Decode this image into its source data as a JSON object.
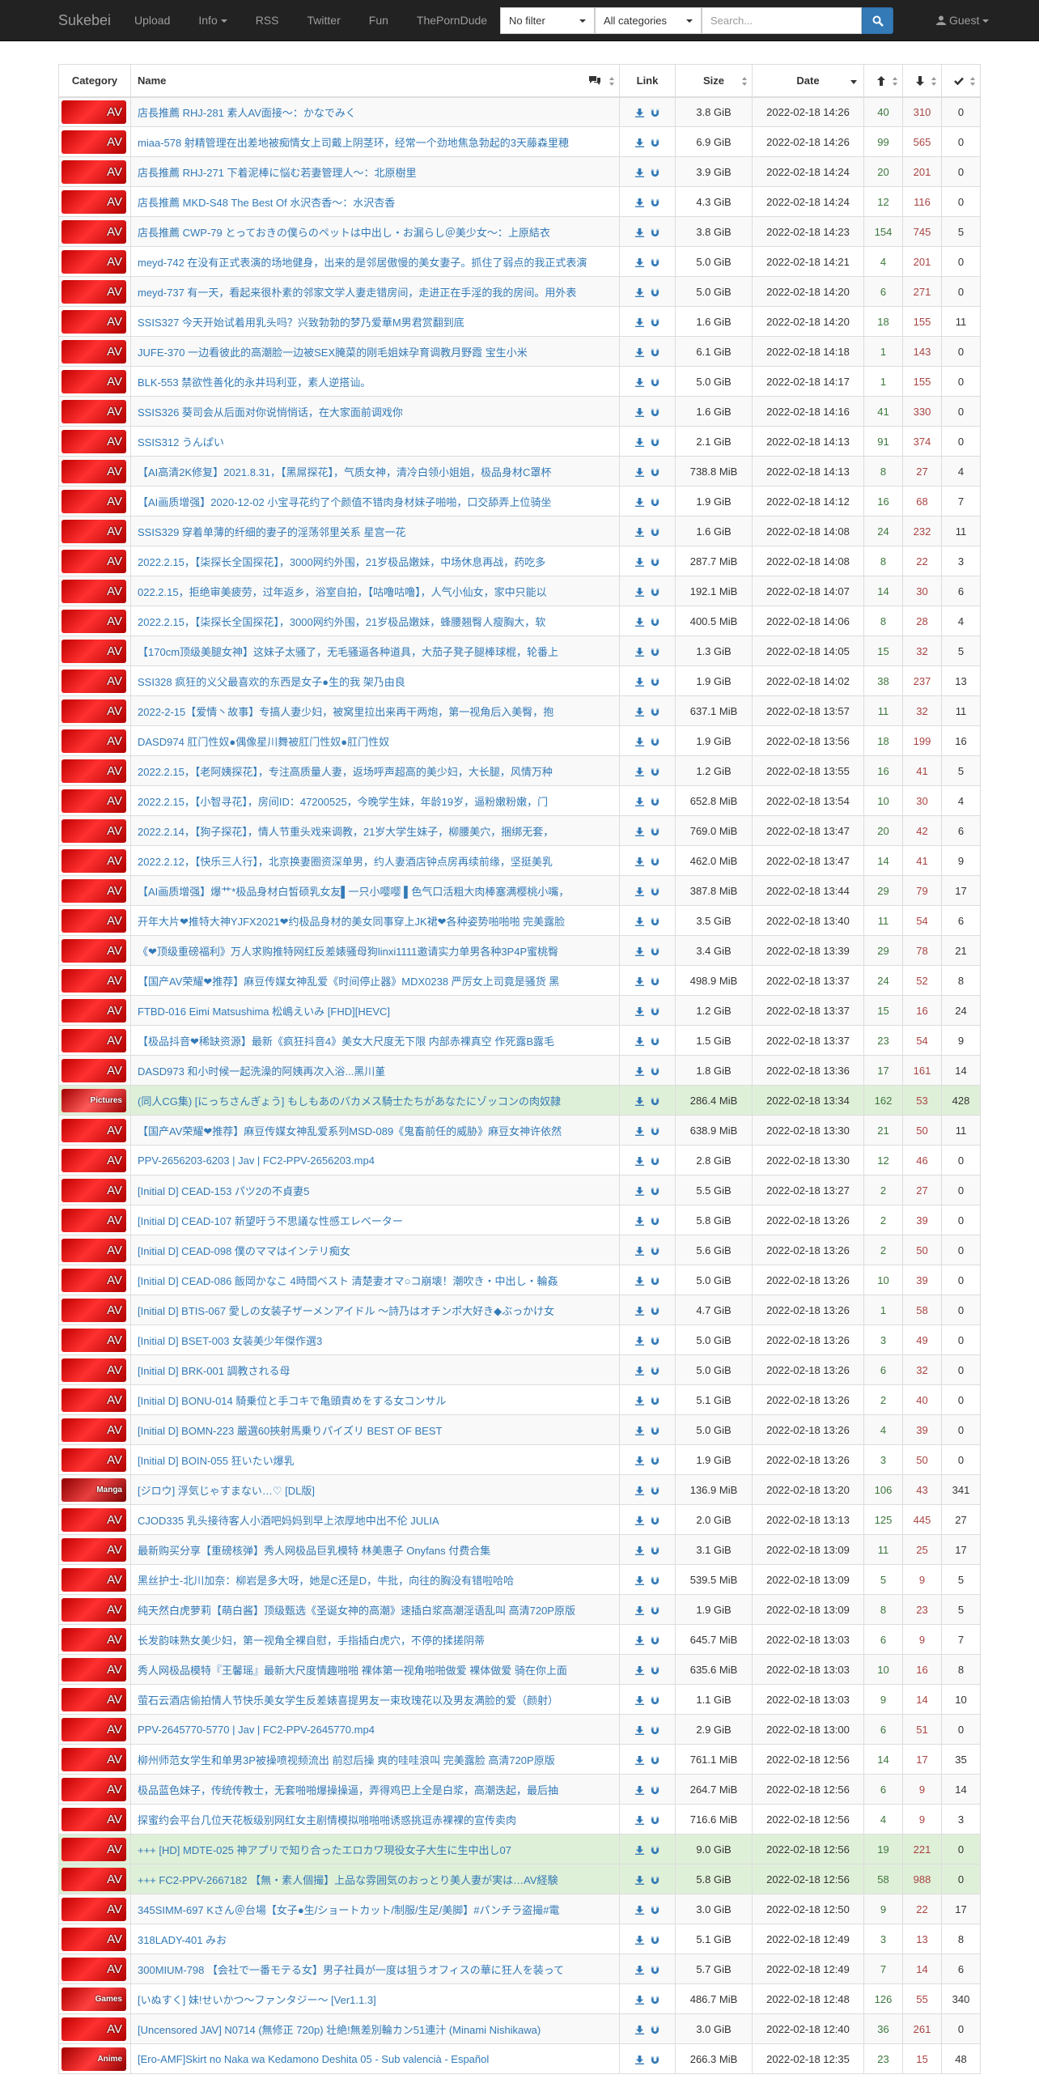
{
  "navbar": {
    "brand": "Sukebei",
    "links": [
      "Upload",
      "Info",
      "RSS",
      "Twitter",
      "Fun",
      "ThePornDude"
    ],
    "filter_value": "No filter",
    "category_value": "All categories",
    "search_placeholder": "Search...",
    "user_label": "Guest"
  },
  "table": {
    "headers": {
      "category": "Category",
      "name": "Name",
      "link": "Link",
      "size": "Size",
      "date": "Date"
    },
    "rows": [
      {
        "cat": "AV",
        "name": "店長推薦 RHJ-281 素人AV面接～：かなでみく",
        "size": "3.8 GiB",
        "date": "2022-02-18 14:26",
        "seed": "40",
        "leech": "310",
        "done": "0",
        "hl": false
      },
      {
        "cat": "AV",
        "name": "miaa-578 射精管理在出差地被痴情女上司戴上阴茎环，经常一个劲地焦急勃起的3天藤森里穂",
        "size": "6.9 GiB",
        "date": "2022-02-18 14:26",
        "seed": "99",
        "leech": "565",
        "done": "0",
        "hl": false
      },
      {
        "cat": "AV",
        "name": "店長推薦 RHJ-271 下着泥棒に悩む若妻管理人～：北原樹里",
        "size": "3.9 GiB",
        "date": "2022-02-18 14:24",
        "seed": "20",
        "leech": "201",
        "done": "0",
        "hl": false
      },
      {
        "cat": "AV",
        "name": "店長推薦 MKD-S48 The Best Of 水沢杏香～：水沢杏香",
        "size": "4.3 GiB",
        "date": "2022-02-18 14:24",
        "seed": "12",
        "leech": "116",
        "done": "0",
        "hl": false
      },
      {
        "cat": "AV",
        "name": "店長推薦 CWP-79 とっておきの僕らのペットは中出し・お漏らし＠美少女～：上原結衣",
        "size": "3.8 GiB",
        "date": "2022-02-18 14:23",
        "seed": "154",
        "leech": "745",
        "done": "5",
        "hl": false
      },
      {
        "cat": "AV",
        "name": "meyd-742 在没有正式表演的场地健身，出来的是邻居傲慢的美女妻子。抓住了弱点的我正式表演",
        "size": "5.0 GiB",
        "date": "2022-02-18 14:21",
        "seed": "4",
        "leech": "201",
        "done": "0",
        "hl": false
      },
      {
        "cat": "AV",
        "name": "meyd-737 有一天，看起来很朴素的邻家文学人妻走错房间，走进正在手淫的我的房间。用外表",
        "size": "5.0 GiB",
        "date": "2022-02-18 14:20",
        "seed": "6",
        "leech": "271",
        "done": "0",
        "hl": false
      },
      {
        "cat": "AV",
        "name": "SSIS327 今天开始试着用乳头吗？兴致勃勃的梦乃爱華M男君赏翻到底",
        "size": "1.6 GiB",
        "date": "2022-02-18 14:20",
        "seed": "18",
        "leech": "155",
        "done": "11",
        "hl": false
      },
      {
        "cat": "AV",
        "name": "JUFE-370 一边看彼此的高潮脸一边被SEX腌菜的刚毛姐妹孕育调教月野霞 宝生小米",
        "size": "6.1 GiB",
        "date": "2022-02-18 14:18",
        "seed": "1",
        "leech": "143",
        "done": "0",
        "hl": false
      },
      {
        "cat": "AV",
        "name": "BLK-553 禁欲性善化的永井玛利亚，素人逆搭讪。",
        "size": "5.0 GiB",
        "date": "2022-02-18 14:17",
        "seed": "1",
        "leech": "155",
        "done": "0",
        "hl": false
      },
      {
        "cat": "AV",
        "name": "SSIS326 葵司会从后面对你说悄悄话，在大家面前调戏你",
        "size": "1.6 GiB",
        "date": "2022-02-18 14:16",
        "seed": "41",
        "leech": "330",
        "done": "0",
        "hl": false
      },
      {
        "cat": "AV",
        "name": "SSIS312 うんぱい",
        "size": "2.1 GiB",
        "date": "2022-02-18 14:13",
        "seed": "91",
        "leech": "374",
        "done": "0",
        "hl": false
      },
      {
        "cat": "AV",
        "name": "【AI高清2K修复】2021.8.31，【黑屌探花】，气质女神，清冷白领小姐姐，极品身材C罩杯",
        "size": "738.8 MiB",
        "date": "2022-02-18 14:13",
        "seed": "8",
        "leech": "27",
        "done": "4",
        "hl": false
      },
      {
        "cat": "AV",
        "name": "【AI画质增强】2020-12-02 小宝寻花约了个颜值不错肉身材妹子啪啪，口交舔弄上位骑坐",
        "size": "1.9 GiB",
        "date": "2022-02-18 14:12",
        "seed": "16",
        "leech": "68",
        "done": "7",
        "hl": false
      },
      {
        "cat": "AV",
        "name": "SSIS329 穿着单薄的纤细的妻子的淫荡邻里关系 星宫一花",
        "size": "1.6 GiB",
        "date": "2022-02-18 14:08",
        "seed": "24",
        "leech": "232",
        "done": "11",
        "hl": false
      },
      {
        "cat": "AV",
        "name": "2022.2.15，【柒探长全国探花】，3000网约外围，21岁极品嫩妹，中场休息再战，药吃多",
        "size": "287.7 MiB",
        "date": "2022-02-18 14:08",
        "seed": "8",
        "leech": "22",
        "done": "3",
        "hl": false
      },
      {
        "cat": "AV",
        "name": "022.2.15，拒绝审美疲劳，过年返乡，浴室自拍，【咕噜咕噜】，人气小仙女，家中只能以",
        "size": "192.1 MiB",
        "date": "2022-02-18 14:07",
        "seed": "14",
        "leech": "30",
        "done": "6",
        "hl": false
      },
      {
        "cat": "AV",
        "name": "2022.2.15，【柒探长全国探花】，3000网约外围，21岁极品嫩妹，蜂腰翘臀人瘦胸大，软",
        "size": "400.5 MiB",
        "date": "2022-02-18 14:06",
        "seed": "8",
        "leech": "28",
        "done": "4",
        "hl": false
      },
      {
        "cat": "AV",
        "name": "【170cm顶级美腿女神】这妹子太骚了，无毛骚逼各种道具，大茄子凳子腿棒球棍，轮番上",
        "size": "1.3 GiB",
        "date": "2022-02-18 14:05",
        "seed": "15",
        "leech": "32",
        "done": "5",
        "hl": false
      },
      {
        "cat": "AV",
        "name": "SSI328 疯狂的义父最喜欢的东西是女子●生的我 架乃由良",
        "size": "1.9 GiB",
        "date": "2022-02-18 14:02",
        "seed": "38",
        "leech": "237",
        "done": "13",
        "hl": false
      },
      {
        "cat": "AV",
        "name": "2022-2-15【爱情丶故事】专搞人妻少妇，被窝里拉出来再干两炮，第一视角后入美臀，抱",
        "size": "637.1 MiB",
        "date": "2022-02-18 13:57",
        "seed": "11",
        "leech": "32",
        "done": "11",
        "hl": false
      },
      {
        "cat": "AV",
        "name": "DASD974 肛门性奴●偶像星川舞被肛门性奴●肛门性奴",
        "size": "1.9 GiB",
        "date": "2022-02-18 13:56",
        "seed": "18",
        "leech": "199",
        "done": "16",
        "hl": false
      },
      {
        "cat": "AV",
        "name": "2022.2.15，【老阿姨探花】，专注高质量人妻，返场呼声超高的美少妇，大长腿，风情万种",
        "size": "1.2 GiB",
        "date": "2022-02-18 13:55",
        "seed": "16",
        "leech": "41",
        "done": "5",
        "hl": false
      },
      {
        "cat": "AV",
        "name": "2022.2.15，【小智寻花】，房间ID：47200525，今晚学生妹，年龄19岁，逼粉嫩粉嫩，门",
        "size": "652.8 MiB",
        "date": "2022-02-18 13:54",
        "seed": "10",
        "leech": "30",
        "done": "4",
        "hl": false
      },
      {
        "cat": "AV",
        "name": "2022.2.14，【狗子探花】，情人节重头戏来调教，21岁大学生妹子，柳腰美穴，捆绑无套，",
        "size": "769.0 MiB",
        "date": "2022-02-18 13:47",
        "seed": "20",
        "leech": "42",
        "done": "6",
        "hl": false
      },
      {
        "cat": "AV",
        "name": "2022.2.12，【快乐三人行】，北京换妻圈资深单男，约人妻酒店钟点房再续前缘，坚挺美乳",
        "size": "462.0 MiB",
        "date": "2022-02-18 13:47",
        "seed": "14",
        "leech": "41",
        "done": "9",
        "hl": false
      },
      {
        "cat": "AV",
        "name": "【AI画质增强】爆艹*极品身材白皙硕乳女友▌一只小嘤嘤 ▌色气口活粗大肉棒塞满樱桃小嘴，",
        "size": "387.8 MiB",
        "date": "2022-02-18 13:44",
        "seed": "29",
        "leech": "79",
        "done": "17",
        "hl": false
      },
      {
        "cat": "AV",
        "name": "开年大片❤推特大神YJFX2021❤约极品身材的美女同事穿上JK裙❤各种姿势啪啪啪 完美露脸",
        "size": "3.5 GiB",
        "date": "2022-02-18 13:40",
        "seed": "11",
        "leech": "54",
        "done": "6",
        "hl": false
      },
      {
        "cat": "AV",
        "name": "《❤顶级重磅福利》万人求购推特网红反差婊骚母狗linxi1111邀请实力单男各种3P4P蜜桃臀",
        "size": "3.4 GiB",
        "date": "2022-02-18 13:39",
        "seed": "29",
        "leech": "78",
        "done": "21",
        "hl": false
      },
      {
        "cat": "AV",
        "name": "【国产AV荣耀❤推荐】麻豆传媒女神乱爱《时间停止器》MDX0238 严厉女上司竟是骚货 黑",
        "size": "498.9 MiB",
        "date": "2022-02-18 13:37",
        "seed": "24",
        "leech": "52",
        "done": "8",
        "hl": false
      },
      {
        "cat": "AV",
        "name": "FTBD-016 Eimi Matsushima 松嶋えいみ [FHD][HEVC]",
        "size": "1.2 GiB",
        "date": "2022-02-18 13:37",
        "seed": "15",
        "leech": "16",
        "done": "24",
        "hl": false
      },
      {
        "cat": "AV",
        "name": "【极品抖音❤稀缺资源】最新《疯狂抖音4》美女大尺度无下限 内部赤裸真空 作死露B露毛",
        "size": "1.5 GiB",
        "date": "2022-02-18 13:37",
        "seed": "23",
        "leech": "54",
        "done": "9",
        "hl": false
      },
      {
        "cat": "AV",
        "name": "DASD973 和小时候一起洗澡的阿姨再次入浴...黑川堇",
        "size": "1.8 GiB",
        "date": "2022-02-18 13:36",
        "seed": "17",
        "leech": "161",
        "done": "14",
        "hl": false
      },
      {
        "cat": "Pictures",
        "name": "(同人CG集) [にっちさんぎょう] もしもあのバカメス騎士たちがあなたにゾッコンの肉奴隷",
        "size": "286.4 MiB",
        "date": "2022-02-18 13:34",
        "seed": "162",
        "leech": "53",
        "done": "428",
        "hl": true
      },
      {
        "cat": "AV",
        "name": "【国产AV荣耀❤推荐】麻豆传媒女神乱爱系列MSD-089《鬼畜前任的威胁》麻豆女神许依然",
        "size": "638.9 MiB",
        "date": "2022-02-18 13:30",
        "seed": "21",
        "leech": "50",
        "done": "11",
        "hl": false
      },
      {
        "cat": "AV",
        "name": "PPV-2656203-6203 | Jav | FC2-PPV-2656203.mp4",
        "size": "2.8 GiB",
        "date": "2022-02-18 13:30",
        "seed": "12",
        "leech": "46",
        "done": "0",
        "hl": false
      },
      {
        "cat": "AV",
        "name": "[Initial D] CEAD-153 パツ2の不貞妻5",
        "size": "5.5 GiB",
        "date": "2022-02-18 13:27",
        "seed": "2",
        "leech": "27",
        "done": "0",
        "hl": false
      },
      {
        "cat": "AV",
        "name": "[Initial D] CEAD-107 新望吁う不思議な性感エレベーター",
        "size": "5.8 GiB",
        "date": "2022-02-18 13:26",
        "seed": "2",
        "leech": "39",
        "done": "0",
        "hl": false
      },
      {
        "cat": "AV",
        "name": "[Initial D] CEAD-098 僕のママはインテリ痴女",
        "size": "5.6 GiB",
        "date": "2022-02-18 13:26",
        "seed": "2",
        "leech": "50",
        "done": "0",
        "hl": false
      },
      {
        "cat": "AV",
        "name": "[Initial D] CEAD-086 飯岡かなこ 4時間ベスト 清楚妻オマ○コ崩壊！潮吹き・中出し・輪姦",
        "size": "5.0 GiB",
        "date": "2022-02-18 13:26",
        "seed": "10",
        "leech": "39",
        "done": "0",
        "hl": false
      },
      {
        "cat": "AV",
        "name": "[Initial D] BTIS-067 愛しの女装子ザーメンアイドル ～詩乃はオチンポ大好き◆ぶっかけ女",
        "size": "4.7 GiB",
        "date": "2022-02-18 13:26",
        "seed": "1",
        "leech": "58",
        "done": "0",
        "hl": false
      },
      {
        "cat": "AV",
        "name": "[Initial D] BSET-003 女装美少年傑作選3",
        "size": "5.0 GiB",
        "date": "2022-02-18 13:26",
        "seed": "3",
        "leech": "49",
        "done": "0",
        "hl": false
      },
      {
        "cat": "AV",
        "name": "[Initial D] BRK-001 調教される母",
        "size": "5.0 GiB",
        "date": "2022-02-18 13:26",
        "seed": "6",
        "leech": "32",
        "done": "0",
        "hl": false
      },
      {
        "cat": "AV",
        "name": "[Initial D] BONU-014 騎乗位と手コキで亀頭責めをする女コンサル",
        "size": "5.1 GiB",
        "date": "2022-02-18 13:26",
        "seed": "2",
        "leech": "40",
        "done": "0",
        "hl": false
      },
      {
        "cat": "AV",
        "name": "[Initial D] BOMN-223 嚴選60挾射馬乗りパイズリ BEST OF BEST",
        "size": "5.0 GiB",
        "date": "2022-02-18 13:26",
        "seed": "4",
        "leech": "39",
        "done": "0",
        "hl": false
      },
      {
        "cat": "AV",
        "name": "[Initial D] BOIN-055 狂いたい爆乳",
        "size": "1.9 GiB",
        "date": "2022-02-18 13:26",
        "seed": "3",
        "leech": "50",
        "done": "0",
        "hl": false
      },
      {
        "cat": "Manga",
        "name": "[ジロウ] 浮気じゃすまない…♡ [DL版]",
        "size": "136.9 MiB",
        "date": "2022-02-18 13:20",
        "seed": "106",
        "leech": "43",
        "done": "341",
        "hl": false
      },
      {
        "cat": "AV",
        "name": "CJOD335 乳头接待客人小酒吧妈妈到早上浓厚地中出不伦 JULIA",
        "size": "2.0 GiB",
        "date": "2022-02-18 13:13",
        "seed": "125",
        "leech": "445",
        "done": "27",
        "hl": false
      },
      {
        "cat": "AV",
        "name": "最新购买分享【重磅核弹】秀人网极品巨乳模特 林美惠子 Onyfans 付费合集",
        "size": "3.1 GiB",
        "date": "2022-02-18 13:09",
        "seed": "11",
        "leech": "25",
        "done": "17",
        "hl": false
      },
      {
        "cat": "AV",
        "name": "黑丝护士-北川加奈：柳岩是多大呀，她是C还是D，牛批，向往的胸没有错啦哈哈",
        "size": "539.5 MiB",
        "date": "2022-02-18 13:09",
        "seed": "5",
        "leech": "9",
        "done": "5",
        "hl": false
      },
      {
        "cat": "AV",
        "name": "纯天然白虎萝莉【萌白酱】顶级甄选《圣诞女神的高潮》速插白浆高潮淫语乱叫 高清720P原版",
        "size": "1.9 GiB",
        "date": "2022-02-18 13:09",
        "seed": "8",
        "leech": "23",
        "done": "5",
        "hl": false
      },
      {
        "cat": "AV",
        "name": "长发韵味熟女美少妇，第一视角全裸自慰，手指插白虎穴，不停的揉搓阴蒂",
        "size": "645.7 MiB",
        "date": "2022-02-18 13:03",
        "seed": "6",
        "leech": "9",
        "done": "7",
        "hl": false
      },
      {
        "cat": "AV",
        "name": "秀人网极品模特『王馨瑶』最新大尺度情趣啪啪 裸体第一视角啪啪做爱 裸体做爱 骑在你上面",
        "size": "635.6 MiB",
        "date": "2022-02-18 13:03",
        "seed": "10",
        "leech": "16",
        "done": "8",
        "hl": false
      },
      {
        "cat": "AV",
        "name": "萤石云酒店偷拍情人节快乐美女学生反差婊喜提男友一束玫瑰花以及男友满脸的爱（颜射）",
        "size": "1.1 GiB",
        "date": "2022-02-18 13:03",
        "seed": "9",
        "leech": "14",
        "done": "10",
        "hl": false
      },
      {
        "cat": "AV",
        "name": "PPV-2645770-5770 | Jav | FC2-PPV-2645770.mp4",
        "size": "2.9 GiB",
        "date": "2022-02-18 13:00",
        "seed": "6",
        "leech": "51",
        "done": "0",
        "hl": false
      },
      {
        "cat": "AV",
        "name": "柳州师范女学生和单男3P被操喷视频流出 前怼后操 爽的哇哇浪叫 完美露脸 高清720P原版",
        "size": "761.1 MiB",
        "date": "2022-02-18 12:56",
        "seed": "14",
        "leech": "17",
        "done": "35",
        "hl": false
      },
      {
        "cat": "AV",
        "name": "极品蓝色妹子，传统传教士，无套啪啪爆操操逼，弄得鸡巴上全是白浆，高潮迭起，最后抽",
        "size": "264.7 MiB",
        "date": "2022-02-18 12:56",
        "seed": "6",
        "leech": "9",
        "done": "14",
        "hl": false
      },
      {
        "cat": "AV",
        "name": "探蜜约会平台几位天花板级别网红女主剧情模拟啪啪啪诱惑挑逗赤裸裸的宣传卖肉",
        "size": "716.6 MiB",
        "date": "2022-02-18 12:56",
        "seed": "4",
        "leech": "9",
        "done": "3",
        "hl": false
      },
      {
        "cat": "AV",
        "name": "+++ [HD] MDTE-025 神アプリで知り合ったエロカワ現役女子大生に生中出し07",
        "size": "9.0 GiB",
        "date": "2022-02-18 12:56",
        "seed": "19",
        "leech": "221",
        "done": "0",
        "hl": true
      },
      {
        "cat": "AV",
        "name": "+++ FC2-PPV-2667182 【無・素人個撮】上品な雰囲気のおっとり美人妻が実は…AV経験",
        "size": "5.8 GiB",
        "date": "2022-02-18 12:56",
        "seed": "58",
        "leech": "988",
        "done": "0",
        "hl": true
      },
      {
        "cat": "AV",
        "name": "345SIMM-697 Kさん＠台場【女子●生/ショートカット/制服/生足/美脚】#パンチラ盗撮#電",
        "size": "3.0 GiB",
        "date": "2022-02-18 12:50",
        "seed": "9",
        "leech": "22",
        "done": "17",
        "hl": false
      },
      {
        "cat": "AV",
        "name": "318LADY-401 みお",
        "size": "5.1 GiB",
        "date": "2022-02-18 12:49",
        "seed": "3",
        "leech": "13",
        "done": "8",
        "hl": false
      },
      {
        "cat": "AV",
        "name": "300MIUM-798 【会社で一番モテる女】男子社員が一度は狙うオフィスの華に狂人を装って",
        "size": "5.7 GiB",
        "date": "2022-02-18 12:49",
        "seed": "7",
        "leech": "14",
        "done": "6",
        "hl": false
      },
      {
        "cat": "Games",
        "name": "[いぬすく] 妹!せいかつ～ファンタジー～ [Ver1.1.3]",
        "size": "486.7 MiB",
        "date": "2022-02-18 12:48",
        "seed": "126",
        "leech": "55",
        "done": "340",
        "hl": false
      },
      {
        "cat": "AV",
        "name": "[Uncensored JAV] N0714 (無修正 720p) 壮絶!無差別輪カン51連汁 (Minami Nishikawa)",
        "size": "3.0 GiB",
        "date": "2022-02-18 12:40",
        "seed": "36",
        "leech": "261",
        "done": "0",
        "hl": false
      },
      {
        "cat": "Anime",
        "name": "[Ero-AMF]Skirt no Naka wa Kedamono Deshita 05 - Sub valencià - Español",
        "size": "266.3 MiB",
        "date": "2022-02-18 12:35",
        "seed": "23",
        "leech": "15",
        "done": "48",
        "hl": false
      }
    ]
  },
  "colors": {
    "navbar_bg": "#222222",
    "link": "#337ab7",
    "seeders": "#3c763d",
    "leechers": "#a94442",
    "highlight_row": "#dff0d8"
  }
}
